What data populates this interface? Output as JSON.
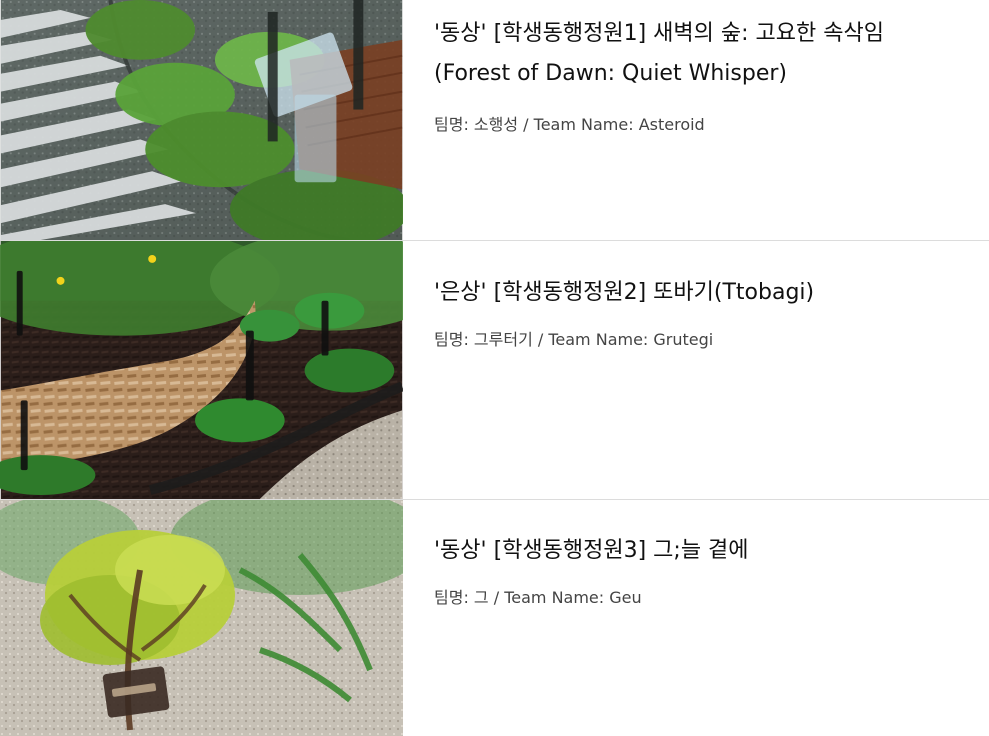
{
  "entries": [
    {
      "title_line1": "'동상' [학생동행정원1] 새벽의 숲: 고요한 속삭임",
      "title_line2": "(Forest of Dawn: Quiet Whisper)",
      "team": "팀명: 소행성 / Team Name: Asteroid",
      "image_icon": "garden-photo-icon"
    },
    {
      "title_line1": "'은상' [학생동행정원2] 또바기(Ttobagi)",
      "title_line2": "",
      "team": "팀명: 그루터기 / Team Name: Grutegi",
      "image_icon": "garden-photo-icon"
    },
    {
      "title_line1": "'동상' [학생동행정원3] 그;늘 곁에",
      "title_line2": "",
      "team": "팀명: 그 / Team Name: Geu",
      "image_icon": "garden-photo-icon"
    }
  ],
  "colors": {
    "text": "#111111",
    "meta": "#444444",
    "divider": "#dcdcdc",
    "foliage": "#4f8b2f",
    "mulch": "#3a2a22",
    "gravel": "#b9b2a6"
  }
}
